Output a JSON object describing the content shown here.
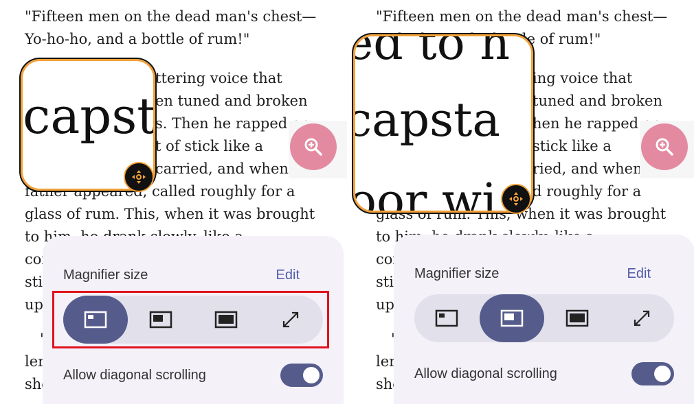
{
  "reading_text": {
    "lines": [
      "\"Fifteen men on the dead man's chest—",
      " Yo-ho-ho, and a bottle of rum!\"",
      "",
      "He sang in the high, old tottering voice that",
      "seemed to have been tuned and broken at the",
      "capstan bars. Then he rapped on the door",
      "with a bit of stick like a handspike that he",
      "carried, and when my",
      "father appeared, called roughly for a",
      "glass of rum. This, when it was brought",
      "to him, he drank slowly, like a"
    ],
    "left_partial_lines": [
      "ttering voice that",
      "en tuned and broken",
      "s. Then he rapped on",
      "t of stick like a",
      "carried, and when my",
      "father appeared, called roughly for a"
    ],
    "right_partial_lines": [
      "ing voice that",
      "tuned and broken",
      "hen he rapped on",
      "stick like a",
      "ried, and when my",
      "d roughly for a",
      "glass of rum. This, when it was brought"
    ],
    "lower_partial": [
      "cor",
      "sti",
      "up",
      "\"",
      "ler",
      "sho"
    ]
  },
  "magnifier": {
    "left_zoom_text": "capst",
    "right_zoom_lines": [
      "ed to h",
      "capsta",
      "oor wi"
    ]
  },
  "fab": {
    "icon": "zoom-in-icon",
    "color": "#e38aa1"
  },
  "settings": {
    "title": "Magnifier size",
    "edit_label": "Edit",
    "size_options": [
      "small-window-icon",
      "medium-window-icon",
      "large-window-icon",
      "fullscreen-icon"
    ],
    "left_selected_index": 0,
    "right_selected_index": 1,
    "diagonal_label": "Allow diagonal scrolling",
    "diagonal_enabled": true
  },
  "colors": {
    "accent": "#555c8c",
    "magnifier_border": "#f2a23a",
    "highlight": "#e0121b"
  }
}
